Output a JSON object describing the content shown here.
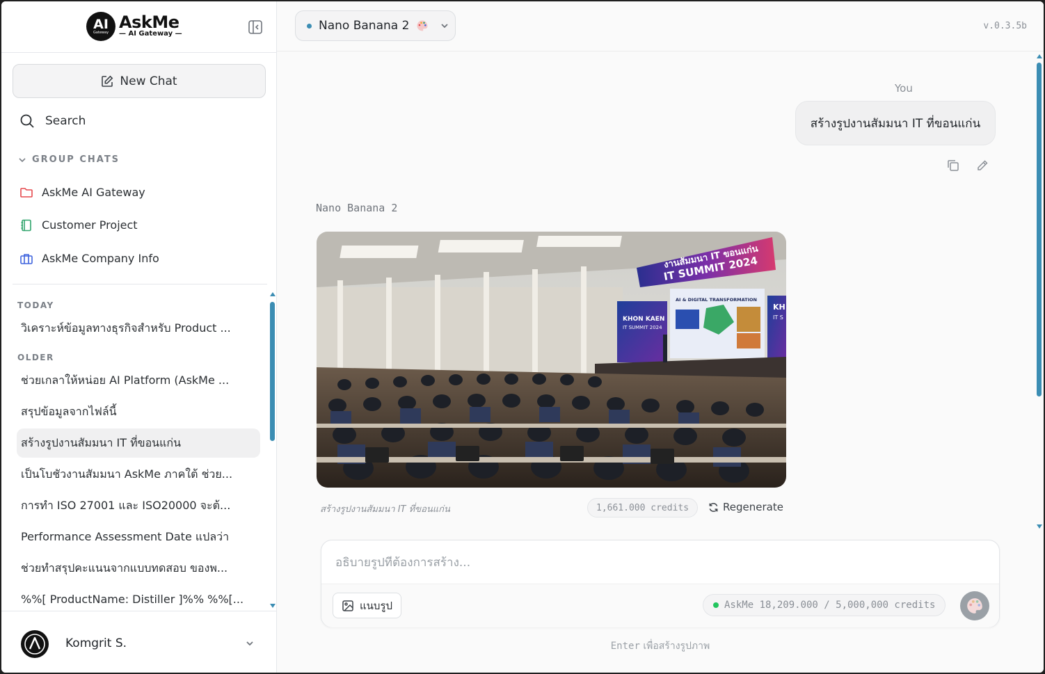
{
  "app": {
    "brand_name": "AskMe",
    "brand_sub": "AI Gateway",
    "logo_initials": "AI",
    "logo_small": "Gateway",
    "version": "v.0.3.5b"
  },
  "sidebar": {
    "new_chat_label": "New Chat",
    "search_label": "Search",
    "group_header": "GROUP CHATS",
    "groups": [
      {
        "label": "AskMe AI Gateway",
        "icon": "folder-icon",
        "color": "#e5484d"
      },
      {
        "label": "Customer Project",
        "icon": "notebook-icon",
        "color": "#30a46c"
      },
      {
        "label": "AskMe Company Info",
        "icon": "briefcase-icon",
        "color": "#3e63dd"
      }
    ],
    "today_label": "TODAY",
    "older_label": "OLDER",
    "today_items": [
      "วิเคราะห์ข้อมูลทางธุรกิจสำหรับ Product ..."
    ],
    "older_items": [
      "ช่วยเกลาให้หน่อย AI Platform (AskMe ...",
      "สรุปข้อมูลจากไฟล์นี้",
      "สร้างรูปงานสัมมนา IT ที่ขอนแก่น",
      "เป็นโบชัวงานสัมมนา AskMe ภาคใต้ ช่วย...",
      "การทำ ISO 27001 และ ISO20000 จะต้...",
      "Performance Assessment Date แปลว่า",
      "ช่วยทำสรุปคะแนนจากแบบทดสอบ ของพ...",
      "%%[ ProductName: Distiller ]%% %%[..."
    ],
    "active_item": "สร้างรูปงานสัมมนา IT ที่ขอนแก่น"
  },
  "user": {
    "name": "Komgrit S.",
    "avatar_text": "A"
  },
  "header": {
    "model_name": "Nano Banana 2",
    "model_icon": "palette-icon"
  },
  "chat": {
    "user_label": "You",
    "user_message": "สร้างรูปงานสัมมนา IT ที่ขอนแก่น",
    "bot_label": "Nano Banana 2",
    "image": {
      "banner_line1": "งานสัมมนา IT ขอนแก่น",
      "banner_line2": "IT SUMMIT 2024",
      "screen_left_line1": "KHON KAEN",
      "screen_left_line2": "IT SUMMIT 2024",
      "screen_center_title": "AI & DIGITAL TRANSFORMATION",
      "screen_right_line1": "KH",
      "screen_right_line2": "IT S"
    },
    "caption": "สร้างรูปงานสัมมนา IT ที่ขอนแก่น",
    "credits_used": "1,661.000 credits",
    "regenerate_label": "Regenerate"
  },
  "composer": {
    "placeholder": "อธิบายรูปที่ต้องการสร้าง...",
    "attach_label": "แนบรูป",
    "balance": "AskMe 18,209.000 / 5,000,000 credits",
    "hint_key": "Enter",
    "hint_text": "เพื่อสร้างรูปภาพ"
  }
}
